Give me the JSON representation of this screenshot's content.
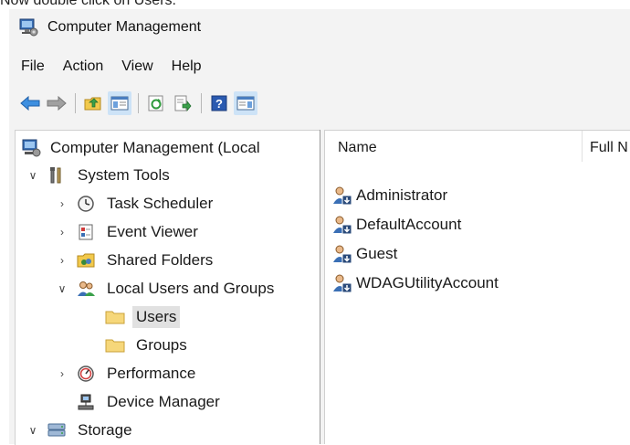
{
  "caption": "Now double click on Users.",
  "window": {
    "title": "Computer Management"
  },
  "menu": [
    "File",
    "Action",
    "View",
    "Help"
  ],
  "tree": {
    "root": "Computer Management (Local",
    "system_tools": "System Tools",
    "task_scheduler": "Task Scheduler",
    "event_viewer": "Event Viewer",
    "shared_folders": "Shared Folders",
    "local_users_groups": "Local Users and Groups",
    "users": "Users",
    "groups": "Groups",
    "performance": "Performance",
    "device_manager": "Device Manager",
    "storage": "Storage"
  },
  "list": {
    "columns": {
      "name": "Name",
      "full_name": "Full N"
    },
    "users": [
      "Administrator",
      "DefaultAccount",
      "Guest",
      "WDAGUtilityAccount"
    ]
  },
  "colors": {
    "selection": "#e1e1e1",
    "toolbar_active": "#cde3f7",
    "background": "#f3f3f3"
  }
}
